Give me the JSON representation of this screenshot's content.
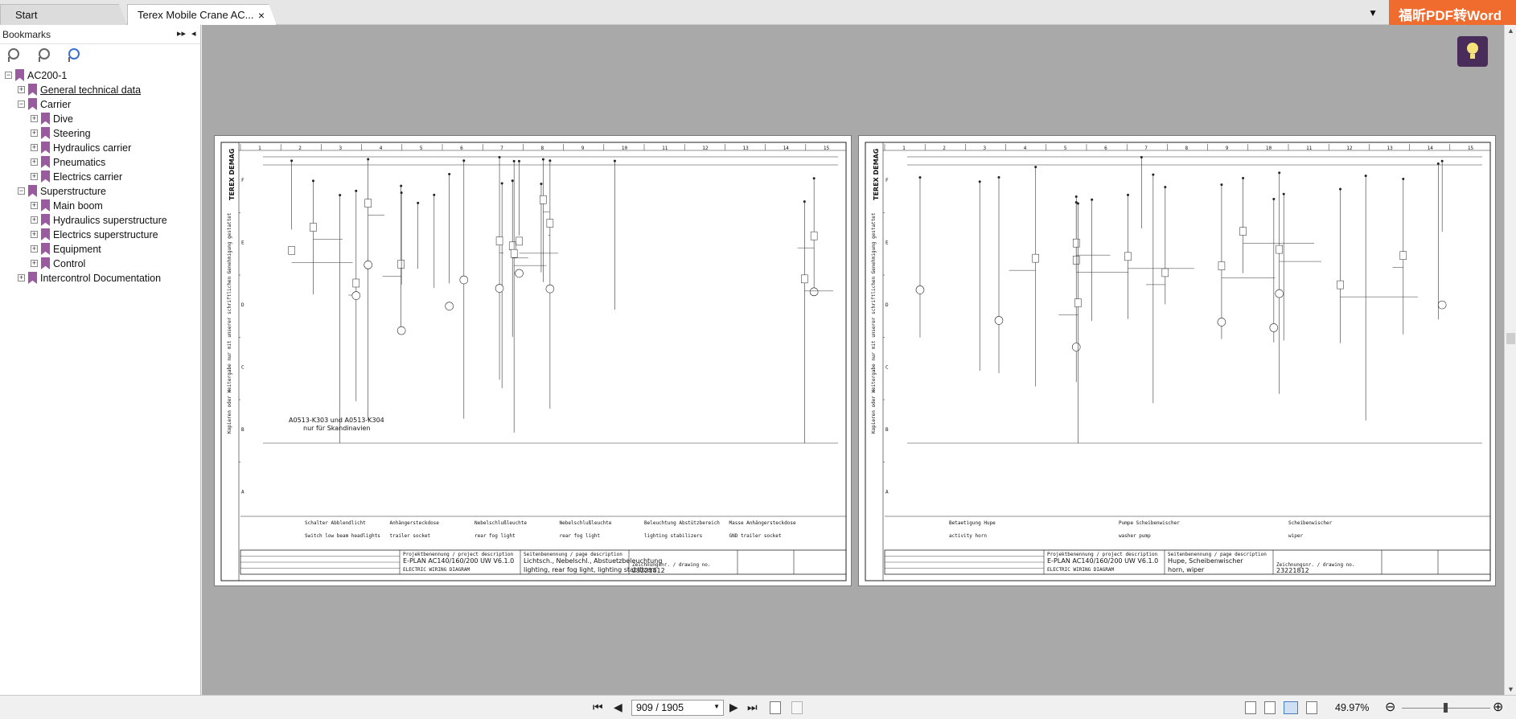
{
  "tabs": [
    {
      "label": "Start"
    },
    {
      "label": "Terex Mobile Crane AC..."
    }
  ],
  "tab_close": "×",
  "tab_dropdown": "▼",
  "brand": "福昕PDF转Word",
  "bookmarks": {
    "title": "Bookmarks",
    "collapse": "▸▸",
    "close": "◂",
    "items": [
      {
        "label": "AC200-1",
        "level": 0,
        "toggle": "−"
      },
      {
        "label": "General technical data",
        "level": 1,
        "toggle": "+"
      },
      {
        "label": "Carrier",
        "level": 1,
        "toggle": "−"
      },
      {
        "label": "Dive",
        "level": 2,
        "toggle": "+"
      },
      {
        "label": "Steering",
        "level": 2,
        "toggle": "+"
      },
      {
        "label": "Hydraulics carrier",
        "level": 2,
        "toggle": "+"
      },
      {
        "label": "Pneumatics",
        "level": 2,
        "toggle": "+"
      },
      {
        "label": "Electrics carrier",
        "level": 2,
        "toggle": "+"
      },
      {
        "label": "Superstructure",
        "level": 1,
        "toggle": "−"
      },
      {
        "label": "Main boom",
        "level": 2,
        "toggle": "+"
      },
      {
        "label": "Hydraulics superstructure",
        "level": 2,
        "toggle": "+"
      },
      {
        "label": "Electrics superstructure",
        "level": 2,
        "toggle": "+"
      },
      {
        "label": "Equipment",
        "level": 2,
        "toggle": "+"
      },
      {
        "label": "Control",
        "level": 2,
        "toggle": "+"
      },
      {
        "label": "Intercontrol Documentation",
        "level": 1,
        "toggle": "+"
      }
    ]
  },
  "pages": [
    {
      "brand": "TEREX DEMAG",
      "side_text": "Kopieren oder Weitergabe nur mit unserer schriftlichen Genehmigung gestattet",
      "note": [
        "A0513-K303 und A0513-K304",
        "nur für Skandinavien"
      ],
      "functions_de": [
        "Schalter Abblendlicht",
        "Anhängersteckdose",
        "Nebelschlußleuchte",
        "Nebelschlußleuchte",
        "Beleuchtung Abstützbereich",
        "Masse Anhängersteckdose"
      ],
      "functions_en": [
        "Switch low beam headlights",
        "trailer socket",
        "rear fog light",
        "rear fog light",
        "lighting stabilizers",
        "GND trailer socket"
      ],
      "project_label": "Projektbenennung / project description",
      "project": "E-PLAN AC140/160/200 UW V6.1.0",
      "project_sub": "ELECTRIC WIRING DIAGRAM",
      "page_label": "Seitenbenennung / page description",
      "page_desc": "Lichtsch., Nebelschl., Abstuetzbeleuchtung",
      "page_desc_en": "lighting, rear fog light, lighting stabilizers",
      "drawing_label": "Zeichnungsnr. / drawing no.",
      "drawing_no": "23221812"
    },
    {
      "brand": "TEREX DEMAG",
      "side_text": "Kopieren oder Weitergabe nur mit unserer schriftlichen Genehmigung gestattet",
      "functions_de": [
        "Betaetigung Hupe",
        "Pumpe Scheibenwischer",
        "Scheibenwischer"
      ],
      "functions_en": [
        "activity horn",
        "washer pump",
        "wiper"
      ],
      "project_label": "Projektbenennung / project description",
      "project": "E-PLAN AC140/160/200 UW V6.1.0",
      "project_sub": "ELECTRIC WIRING DIAGRAM",
      "page_label": "Seitenbenennung / page description",
      "page_desc": "Hupe, Scheibenwischer",
      "page_desc_en": "horn, wiper",
      "drawing_label": "Zeichnungsnr. / drawing no.",
      "drawing_no": "23221812"
    }
  ],
  "columns": [
    "1",
    "2",
    "3",
    "4",
    "5",
    "6",
    "7",
    "8",
    "9",
    "10",
    "11",
    "12",
    "13",
    "14",
    "15"
  ],
  "rows": [
    "F",
    "E",
    "D",
    "C",
    "B",
    "A"
  ],
  "nav": {
    "first": "⏮",
    "prev": "◀",
    "page": "909 / 1905",
    "next": "▶",
    "last": "⏭",
    "dropdown": "▼"
  },
  "zoom": {
    "value": "49.97%",
    "minus": "⊖",
    "plus": "⊕"
  }
}
